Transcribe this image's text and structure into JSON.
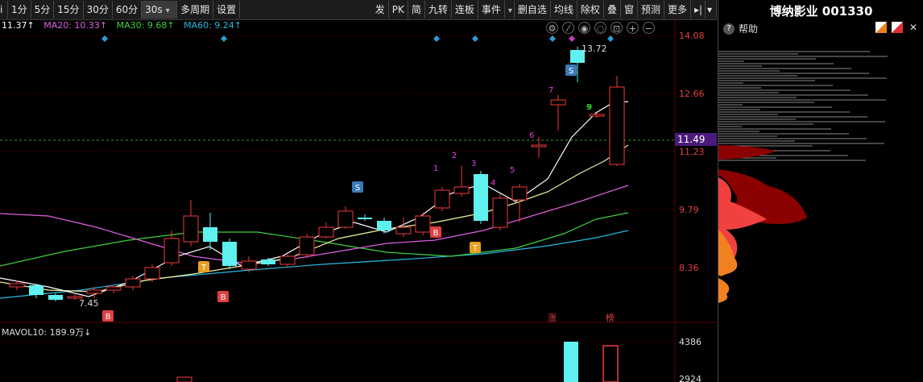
{
  "toolbar": {
    "left_items": [
      "1分",
      "5分",
      "15分",
      "30分",
      "60分",
      "30s",
      "多周期",
      "设置"
    ],
    "selected": "30s",
    "dropdown": "30s",
    "right_items": [
      "发",
      "PK",
      "简",
      "九转",
      "连板",
      "事件",
      "",
      "删自选",
      "均线",
      "除权",
      "叠",
      "窗",
      "预测",
      "更多"
    ]
  },
  "ma_legend": [
    {
      "text": "11.37↑",
      "color": "#ffffff"
    },
    {
      "text": "MA20: 10.33↑",
      "color": "#e060e0"
    },
    {
      "text": "MA30: 9.68↑",
      "color": "#3ed03e"
    },
    {
      "text": "MA60: 9.24↑",
      "color": "#27b8e0"
    }
  ],
  "price_axis": [
    "14.08",
    "12.66",
    "11.23",
    "9.79",
    "8.36"
  ],
  "current_price": "11.49",
  "volume_axis": [
    "4386",
    "2924"
  ],
  "volume_legend": "MAVOL10: 189.9万↓",
  "annotations": {
    "high_label": "13.72",
    "low_label": "7.45",
    "zhang": "涨",
    "bang": "榜"
  },
  "signals": {
    "buy": "B",
    "sell": "S",
    "t": "T"
  },
  "sequence_numbers": [
    "1",
    "2",
    "3",
    "4",
    "5",
    "6",
    "7",
    "9"
  ],
  "right_panel": {
    "title": "博纳影业 001330",
    "help": "帮助"
  },
  "colors": {
    "up": "#f03a3a",
    "down": "#5ff0f0",
    "ma5": "#f0f0a0",
    "ma10": "#ffffff",
    "ma20": "#e060e0",
    "ma30": "#3ed03e",
    "ma60": "#27b8e0"
  }
}
